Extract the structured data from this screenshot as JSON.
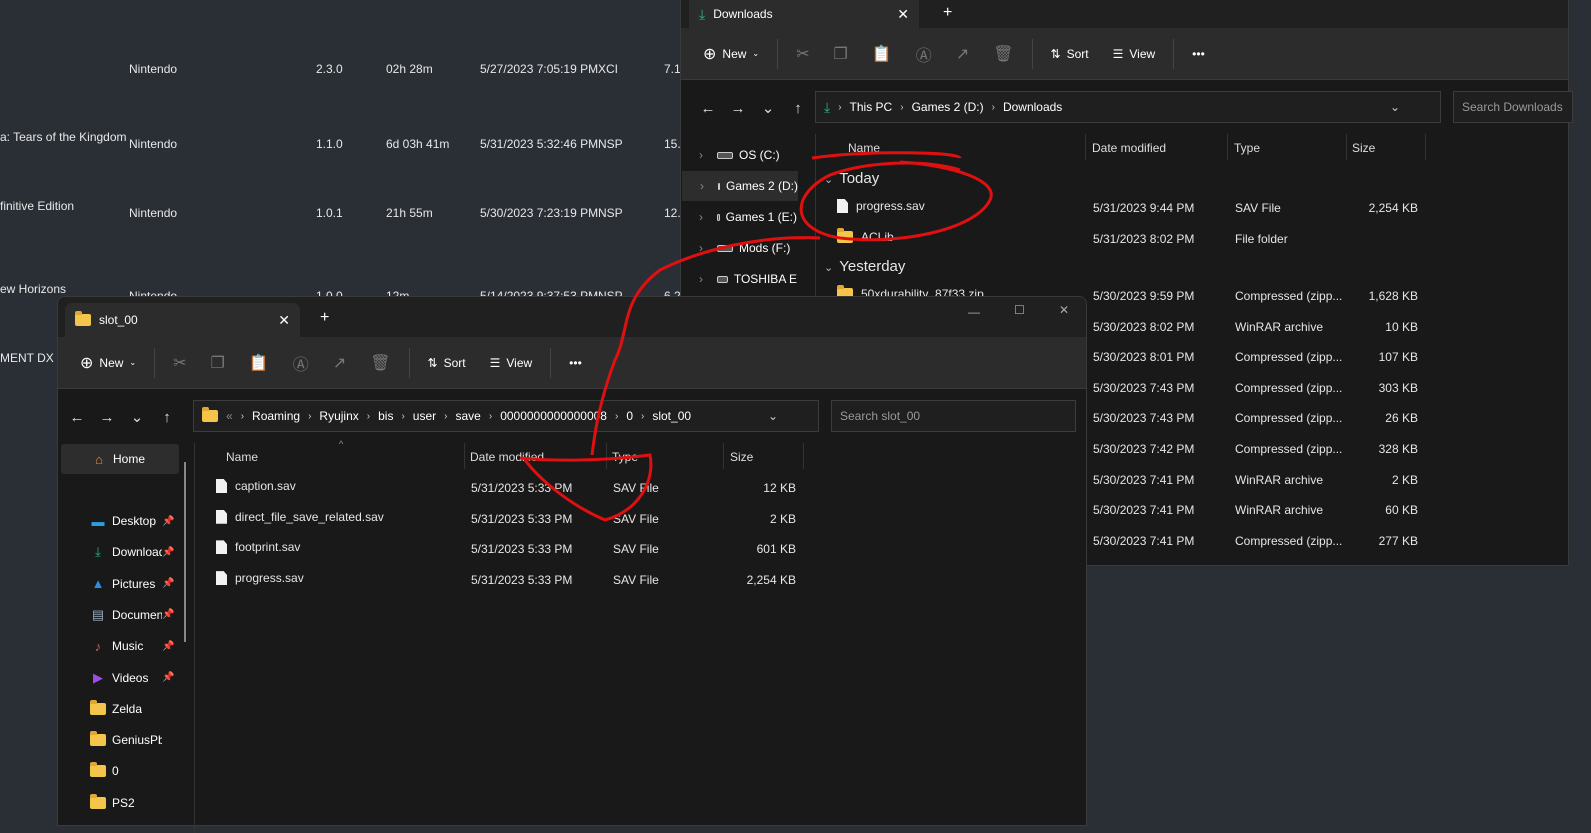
{
  "background_app": {
    "rows": [
      {
        "title": "",
        "developer": "Nintendo",
        "version": "2.3.0",
        "time_played": "02h 28m",
        "last_played": "5/27/2023 7:05:19 PM",
        "format": "XCI",
        "size": "7.1"
      },
      {
        "title": "a: Tears of the Kingdom",
        "developer": "Nintendo",
        "version": "1.1.0",
        "time_played": "6d 03h 41m",
        "last_played": "5/31/2023 5:32:46 PM",
        "format": "NSP",
        "size": "15."
      },
      {
        "title": "finitive Edition",
        "developer": "Nintendo",
        "version": "1.0.1",
        "time_played": "21h 55m",
        "last_played": "5/30/2023 7:23:19 PM",
        "format": "NSP",
        "size": "12."
      },
      {
        "title": "ew Horizons",
        "developer": "Nintendo",
        "version": "1.0.0",
        "time_played": "12m",
        "last_played": "5/14/2023 9:37:53 PM",
        "format": "NSP",
        "size": "6.2"
      },
      {
        "title": "MENT DX",
        "developer": "",
        "version": "",
        "time_played": "",
        "last_played": "",
        "format": "",
        "size": ""
      }
    ]
  },
  "downloads": {
    "tab_title": "Downloads",
    "toolbar": {
      "new": "New",
      "sort": "Sort",
      "view": "View",
      "more": "•••"
    },
    "breadcrumb": [
      "This PC",
      "Games 2 (D:)",
      "Downloads"
    ],
    "search_placeholder": "Search Downloads",
    "sidebar": [
      "OS (C:)",
      "Games 2 (D:)",
      "Games 1 (E:)",
      "Mods (F:)",
      "TOSHIBA E"
    ],
    "columns": [
      "Name",
      "Date modified",
      "Type",
      "Size"
    ],
    "groups": [
      {
        "label": "Today",
        "items": [
          {
            "name": "progress.sav",
            "date": "5/31/2023 9:44 PM",
            "type": "SAV File",
            "size": "2,254 KB",
            "icon": "file"
          },
          {
            "name": "ACLib",
            "date": "5/31/2023 8:02 PM",
            "type": "File folder",
            "size": "",
            "icon": "folder"
          }
        ]
      },
      {
        "label": "Yesterday",
        "items": [
          {
            "name": "50xdurability_87f33.zip",
            "date": "5/30/2023 9:59 PM",
            "type": "Compressed (zipp...",
            "size": "1,628 KB",
            "icon": "zip"
          },
          {
            "name": "",
            "date": "5/30/2023 8:02 PM",
            "type": "WinRAR archive",
            "size": "10 KB"
          },
          {
            "name": "",
            "date": "5/30/2023 8:01 PM",
            "type": "Compressed (zipp...",
            "size": "107 KB"
          },
          {
            "name": "",
            "date": "5/30/2023 7:43 PM",
            "type": "Compressed (zipp...",
            "size": "303 KB"
          },
          {
            "name": "",
            "date": "5/30/2023 7:43 PM",
            "type": "Compressed (zipp...",
            "size": "26 KB"
          },
          {
            "name": "",
            "date": "5/30/2023 7:42 PM",
            "type": "Compressed (zipp...",
            "size": "328 KB"
          },
          {
            "name": "",
            "date": "5/30/2023 7:41 PM",
            "type": "WinRAR archive",
            "size": "2 KB"
          },
          {
            "name": "",
            "date": "5/30/2023 7:41 PM",
            "type": "WinRAR archive",
            "size": "60 KB"
          },
          {
            "name": "",
            "date": "5/30/2023 7:41 PM",
            "type": "Compressed (zipp...",
            "size": "277 KB"
          }
        ]
      }
    ]
  },
  "slot": {
    "tab_title": "slot_00",
    "toolbar": {
      "new": "New",
      "sort": "Sort",
      "view": "View",
      "more": "•••"
    },
    "breadcrumb": [
      "Roaming",
      "Ryujinx",
      "bis",
      "user",
      "save",
      "0000000000000008",
      "0",
      "slot_00"
    ],
    "search_placeholder": "Search slot_00",
    "sidebar": [
      {
        "label": "Home"
      },
      {
        "label": "Desktop",
        "pinned": true
      },
      {
        "label": "Downloads",
        "pinned": true
      },
      {
        "label": "Pictures",
        "pinned": true
      },
      {
        "label": "Documents",
        "pinned": true
      },
      {
        "label": "Music",
        "pinned": true
      },
      {
        "label": "Videos",
        "pinned": true
      },
      {
        "label": "Zelda"
      },
      {
        "label": "GeniusPbr"
      },
      {
        "label": "0"
      },
      {
        "label": "PS2"
      }
    ],
    "columns": [
      "Name",
      "Date modified",
      "Type",
      "Size"
    ],
    "files": [
      {
        "name": "caption.sav",
        "date": "5/31/2023 5:33 PM",
        "type": "SAV File",
        "size": "12 KB"
      },
      {
        "name": "direct_file_save_related.sav",
        "date": "5/31/2023 5:33 PM",
        "type": "SAV File",
        "size": "2 KB"
      },
      {
        "name": "footprint.sav",
        "date": "5/31/2023 5:33 PM",
        "type": "SAV File",
        "size": "601 KB"
      },
      {
        "name": "progress.sav",
        "date": "5/31/2023 5:33 PM",
        "type": "SAV File",
        "size": "2,254 KB"
      }
    ]
  },
  "colors": {
    "annotation": "#e01010",
    "download_accent": "#2bb38a",
    "folder": "#f3c64b"
  }
}
